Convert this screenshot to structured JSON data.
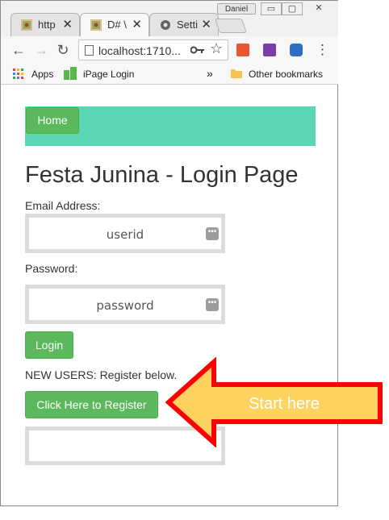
{
  "window": {
    "user": "Daniel",
    "controls": {
      "minimize": "▭",
      "maximize": "▢",
      "close": "✕"
    }
  },
  "tabs": [
    {
      "label": "http",
      "close": "✕"
    },
    {
      "label": "D# \\",
      "close": "✕"
    },
    {
      "label": "Setti",
      "close": "✕"
    }
  ],
  "toolbar": {
    "url": "localhost:1710...",
    "menu": "⋮"
  },
  "bookmarks": {
    "apps": "Apps",
    "ipage": "iPage Login",
    "more": "»",
    "other": "Other bookmarks"
  },
  "page": {
    "nav_home": "Home",
    "title": "Festa Junina - Login Page",
    "email_label": "Email Address:",
    "email_placeholder": "userid",
    "password_label": "Password:",
    "password_placeholder": "password",
    "login_button": "Login",
    "new_users_text": "NEW USERS: Register below.",
    "register_button": "Click Here to Register",
    "field_icon": "•••"
  },
  "annotation": {
    "text": "Start here",
    "fill_color": "#fdd25f",
    "border_color": "#ff0000"
  },
  "colors": {
    "navbar": "#5ad6b7",
    "button_green": "#5cb85c"
  }
}
